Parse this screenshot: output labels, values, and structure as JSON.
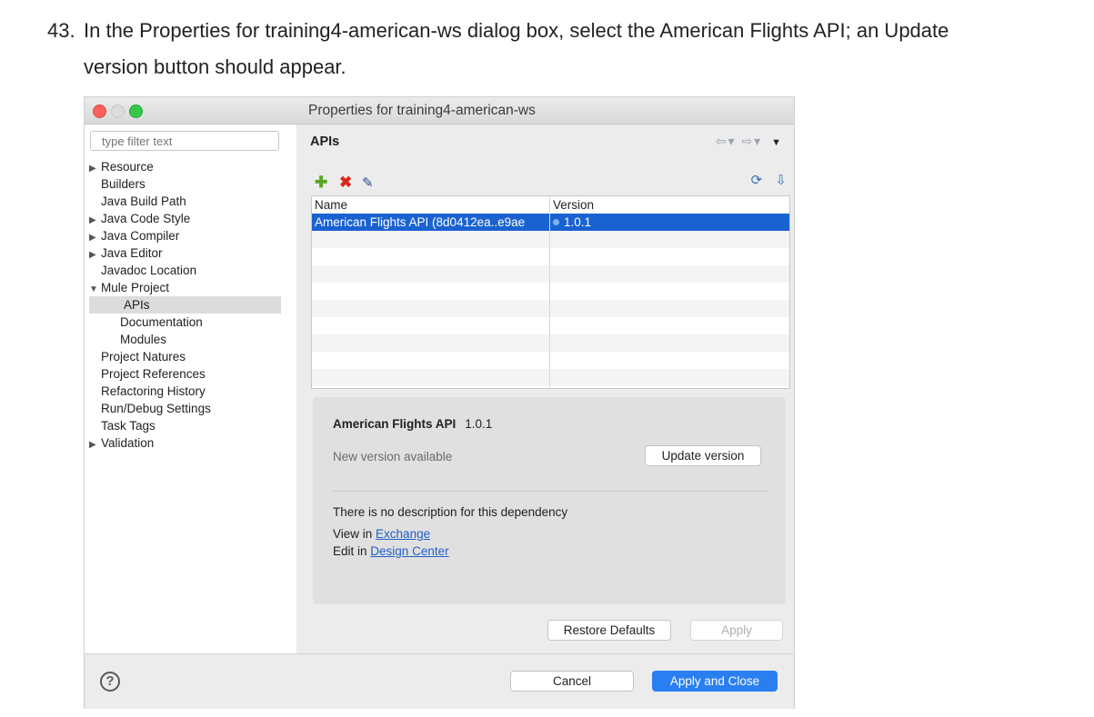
{
  "instruction": {
    "number": "43.",
    "line1": "In the Properties for training4-american-ws dialog box, select the American Flights API; an Update",
    "line2": "version button should appear."
  },
  "dialog": {
    "title": "Properties for training4-american-ws",
    "filter_placeholder": "type filter text",
    "tree": [
      {
        "label": "Resource",
        "expandable": true,
        "expanded": false
      },
      {
        "label": "Builders",
        "expandable": false
      },
      {
        "label": "Java Build Path",
        "expandable": false
      },
      {
        "label": "Java Code Style",
        "expandable": true,
        "expanded": false
      },
      {
        "label": "Java Compiler",
        "expandable": true,
        "expanded": false
      },
      {
        "label": "Java Editor",
        "expandable": true,
        "expanded": false
      },
      {
        "label": "Javadoc Location",
        "expandable": false
      },
      {
        "label": "Mule Project",
        "expandable": true,
        "expanded": true
      },
      {
        "label": "APIs",
        "child": true,
        "selected": true
      },
      {
        "label": "Documentation",
        "child": true
      },
      {
        "label": "Modules",
        "child": true
      },
      {
        "label": "Project Natures",
        "expandable": false
      },
      {
        "label": "Project References",
        "expandable": false
      },
      {
        "label": "Refactoring History",
        "expandable": false
      },
      {
        "label": "Run/Debug Settings",
        "expandable": false
      },
      {
        "label": "Task Tags",
        "expandable": false
      },
      {
        "label": "Validation",
        "expandable": true,
        "expanded": false
      }
    ],
    "page_title": "APIs",
    "table": {
      "columns": [
        "Name",
        "Version"
      ],
      "rows": [
        {
          "name": "American Flights API (8d0412ea..e9ae",
          "version": "1.0.1",
          "selected": true
        }
      ]
    },
    "details": {
      "api_name": "American Flights API",
      "api_version": "1.0.1",
      "new_version_text": "New version available",
      "update_button": "Update version",
      "description": "There is no description for this dependency",
      "view_prefix": "View in",
      "view_link": "Exchange",
      "edit_prefix": "Edit in",
      "edit_link": "Design Center"
    },
    "buttons": {
      "restore_defaults": "Restore Defaults",
      "apply": "Apply",
      "cancel": "Cancel",
      "apply_and_close": "Apply and Close"
    },
    "colors": {
      "selection": "#1b62d1",
      "primary_button": "#2a7ff0",
      "link": "#2060c8"
    }
  }
}
